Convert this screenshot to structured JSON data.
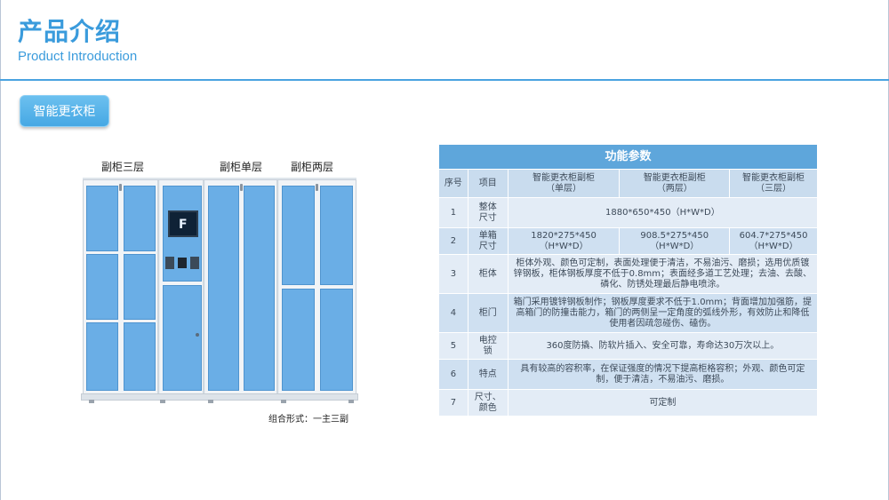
{
  "header": {
    "title": "产品介绍",
    "subtitle": "Product Introduction"
  },
  "category_button": {
    "label": "智能更衣柜"
  },
  "illustration": {
    "labels": {
      "three_tier": "副柜三层",
      "single_tier": "副柜单层",
      "two_tier": "副柜两层"
    },
    "caption": "组合形式：一主三副"
  },
  "table": {
    "title": "功能参数",
    "headers": {
      "no": "序号",
      "item": "项目",
      "single": "智能更衣柜副柜\n（单层）",
      "double": "智能更衣柜副柜\n（两层）",
      "triple": "智能更衣柜副柜\n（三层）"
    },
    "rows": [
      {
        "no": "1",
        "item": "整体\n尺寸",
        "merged": "1880*650*450（H*W*D）"
      },
      {
        "no": "2",
        "item": "单箱\n尺寸",
        "single": "1820*275*450\n（H*W*D）",
        "double": "908.5*275*450（H*W*D）",
        "triple": "604.7*275*450\n（H*W*D）"
      },
      {
        "no": "3",
        "item": "柜体",
        "merged": "柜体外观、颜色可定制，表面处理便于清洁，不易油污、磨损；选用优质镀锌钢板，柜体钢板厚度不低于0.8mm；表面经多道工艺处理；去油、去酸、磷化、防锈处理最后静电喷涂。"
      },
      {
        "no": "4",
        "item": "柜门",
        "merged": "箱门采用镀锌钢板制作；钢板厚度要求不低于1.0mm；背面增加加强筋，提高箱门的防撞击能力，箱门的两侧呈一定角度的弧线外形，有效防止和降低使用者因疏忽碰伤、磕伤。"
      },
      {
        "no": "5",
        "item": "电控\n锁",
        "merged": "360度防撬、防软片插入、安全可靠，寿命达30万次以上。"
      },
      {
        "no": "6",
        "item": "特点",
        "merged": "具有较高的容积率，在保证强度的情况下提高柜格容积；外观、颜色可定制，便于清洁，不易油污、磨损。"
      },
      {
        "no": "7",
        "item": "尺寸、\n颜色",
        "merged": "可定制"
      }
    ]
  },
  "colors": {
    "accent": "#3a9bdc",
    "door": "#6aaee6",
    "table_header": "#5ea6db",
    "table_row_light": "#e3ecf6",
    "table_row_dark": "#cfe0f1"
  }
}
